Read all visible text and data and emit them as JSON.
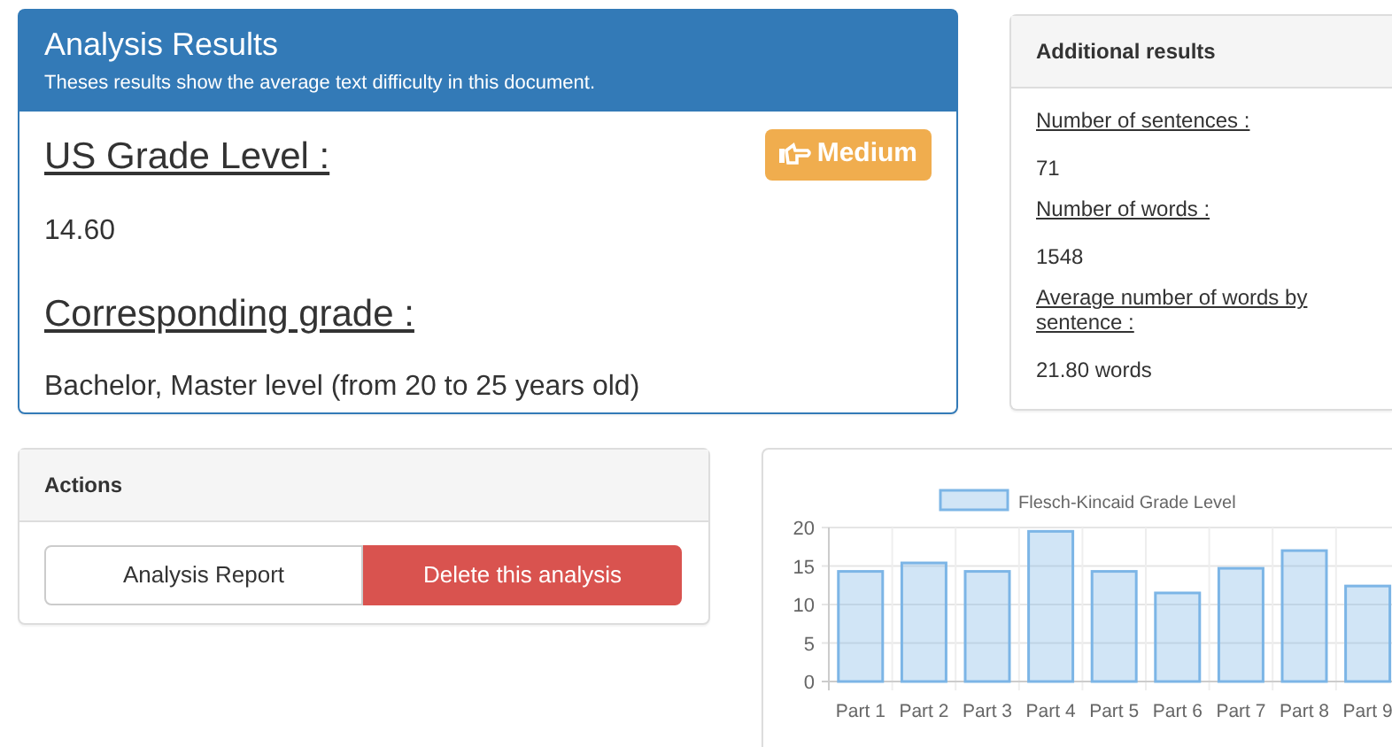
{
  "results_panel": {
    "title": "Analysis Results",
    "subtitle": "Theses results show the average text difficulty in this document.",
    "grade_label": "US Grade Level :",
    "badge": "Medium",
    "grade_value": "14.60",
    "corresponding_label": "Corresponding grade :",
    "corresponding_value": "Bachelor, Master level (from 20 to 25 years old)"
  },
  "additional_panel": {
    "title": "Additional results",
    "items": [
      {
        "label": "Number of sentences :",
        "value": "71"
      },
      {
        "label": "Number of words :",
        "value": "1548"
      },
      {
        "label": "Average number of words by sentence :",
        "value": "21.80 words"
      }
    ]
  },
  "actions_panel": {
    "title": "Actions",
    "buttons": [
      {
        "label": "Analysis Report",
        "kind": "default"
      },
      {
        "label": "Delete this analysis",
        "kind": "danger"
      }
    ]
  },
  "chart_panel": {
    "chart_data": {
      "type": "bar",
      "categories": [
        "Part 1",
        "Part 2",
        "Part 3",
        "Part 4",
        "Part 5",
        "Part 6",
        "Part 7",
        "Part 8",
        "Part 9"
      ],
      "series": [
        {
          "name": "Flesch-Kincaid Grade Level",
          "color": "#7cb5e6",
          "values": [
            14.3,
            15.4,
            14.3,
            19.5,
            14.3,
            11.5,
            14.7,
            17.0,
            12.4
          ]
        }
      ],
      "ylim": [
        0,
        20
      ],
      "yticks": [
        0,
        5,
        10,
        15,
        20
      ],
      "grid": true
    }
  }
}
